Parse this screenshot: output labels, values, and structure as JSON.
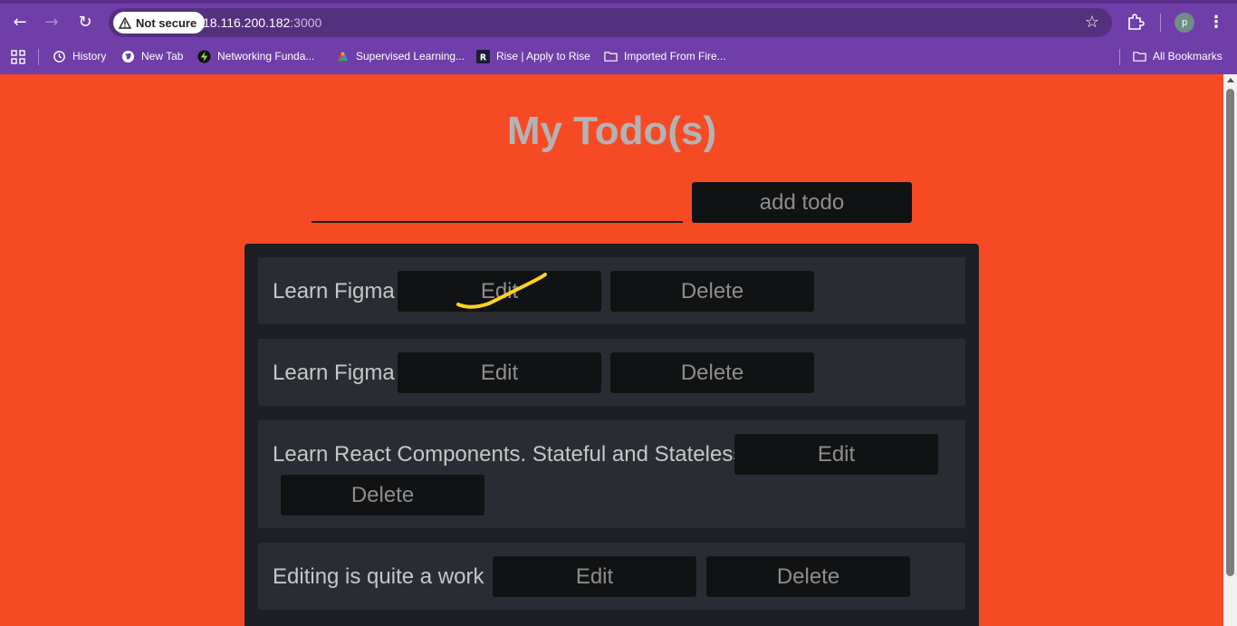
{
  "browser": {
    "security_label": "Not secure",
    "url_host": "18.116.200.182",
    "url_port": ":3000",
    "profile_initial": "p",
    "bookmarks": [
      {
        "label": "History",
        "icon": "history-icon"
      },
      {
        "label": "New Tab",
        "icon": "globe-icon"
      },
      {
        "label": "Networking Funda...",
        "icon": "bolt-icon"
      },
      {
        "label": "Supervised Learning...",
        "icon": "colorful-logo-icon"
      },
      {
        "label": "Rise | Apply to Rise",
        "icon": "rise-logo-icon"
      },
      {
        "label": "Imported From Fire...",
        "icon": "folder-icon"
      }
    ],
    "all_bookmarks_label": "All Bookmarks"
  },
  "app": {
    "title": "My Todo(s)",
    "input_value": "",
    "add_button_label": "add todo",
    "edit_label": "Edit",
    "delete_label": "Delete",
    "todos": [
      {
        "text": "Learn Figma"
      },
      {
        "text": "Learn Figma"
      },
      {
        "text": "Learn React Components. Stateful and Stateless"
      },
      {
        "text": "Editing is quite a work"
      }
    ]
  },
  "colors": {
    "page_background": "#f64a25",
    "browser_chrome": "#6f3ea8",
    "panel": "#1c1f23",
    "card": "#292d33",
    "button": "#101214",
    "annotation_stroke": "#ffd21e"
  }
}
